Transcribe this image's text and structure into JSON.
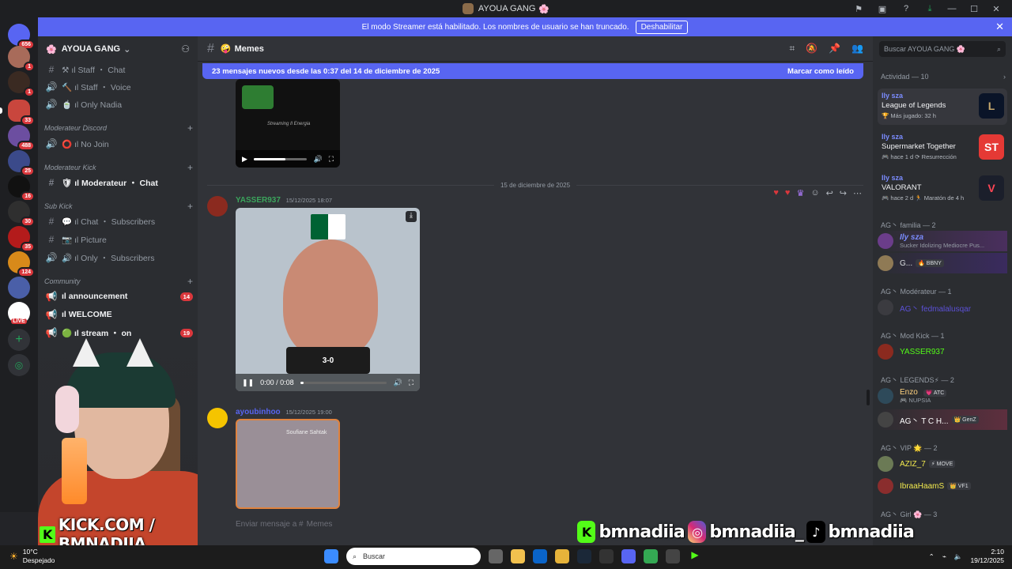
{
  "window": {
    "title": "AYOUA GANG",
    "title_emoji": "🌸"
  },
  "banner": {
    "text": "El modo Streamer está habilitado. Los nombres de usuario se han truncado.",
    "button": "Deshabilitar"
  },
  "servers": {
    "badges": [
      "656",
      "1",
      "1",
      "33",
      "488",
      "25",
      "16",
      "30",
      "35",
      "124"
    ],
    "live_label": "LIVE"
  },
  "guild": {
    "name": "AYOUA GANG",
    "emoji": "🌸"
  },
  "channels": [
    {
      "icon": "#",
      "label": "⚒ ıl Staff ・ Chat"
    },
    {
      "icon": "🔊",
      "label": "🔨 ıl Staff ・ Voice"
    },
    {
      "icon": "🔊",
      "label": "🍵 ıl Only Nadia"
    },
    {
      "category": "Moderateur Discord"
    },
    {
      "icon": "🔊",
      "label": "⭕ ıl No Join"
    },
    {
      "category": "Moderateur Kick"
    },
    {
      "icon": "#",
      "label": "🛡 ıl Moderateur ・ Chat",
      "bold": true
    },
    {
      "category": "Sub Kick"
    },
    {
      "icon": "#",
      "label": "💬 ıl Chat ・ Subscribers"
    },
    {
      "icon": "#",
      "label": "📷 ıl Picture"
    },
    {
      "icon": "🔊",
      "label": "🔊 ıl Only ・ Subscribers"
    },
    {
      "category": "Community"
    },
    {
      "icon": "📢",
      "label": "ıl announcement",
      "bold": true,
      "badge": "14"
    },
    {
      "icon": "📢",
      "label": "ıl WELCOME",
      "bold": true
    },
    {
      "icon": "📢",
      "label": "🟢 ıl stream ・ on",
      "bold": true,
      "badge": "19"
    }
  ],
  "webcam_tag": "KICK.COM / BMNADIIA",
  "chat_header": {
    "name": "Memes",
    "emoji": "🤪"
  },
  "new_messages": {
    "text": "23 mensajes nuevos desde las 0:37 del 14 de diciembre de 2025",
    "mark": "Marcar como leído"
  },
  "messages": [
    {
      "author": "YASSER937",
      "time": "15/12/2025 18:07",
      "color": "#3ba55c",
      "video_time": "0:00 / 0:08",
      "score": "3-0"
    },
    {
      "author": "ayoubinhoo",
      "time": "15/12/2025 19:00",
      "color": "#5865f2",
      "watermark": "Soufiane Sahtak"
    }
  ],
  "date_divider": "15 de diciembre de 2025",
  "first_video_caption": "Streaming Il Energia",
  "composer_placeholder": "Enviar mensaje a #",
  "composer_channel": "Memes",
  "members": {
    "search_placeholder": "Buscar AYOUA GANG 🌸",
    "activity_header": "Actividad — 10",
    "activities": [
      {
        "name": "Ily sza",
        "game": "League of Legends",
        "meta": "🏆 Más jugado: 32 h",
        "art": "L",
        "art_color": "#0a1428"
      },
      {
        "name": "Ily sza",
        "game": "Supermarket Together",
        "meta": "🎮 hace 1 d   ⟳ Resurrección",
        "art": "ST",
        "art_color": "#e53935"
      },
      {
        "name": "Ily sza",
        "game": "VALORANT",
        "meta": "🎮 hace 2 d   🏃 Maratón de 4 h",
        "art": "V",
        "art_color": "#1b1f2b"
      }
    ],
    "groups": [
      {
        "header": "AG丶 familia — 2",
        "members": [
          {
            "name": "Ily sza",
            "sub": "Sucker Idolizing Mediocre Pus...",
            "color": "#7b8cff"
          },
          {
            "name": "G...",
            "tag": "🔥 BBNY",
            "color": "#dbdee1"
          }
        ]
      },
      {
        "header": "AG丶 Modérateur — 1",
        "members": [
          {
            "name": "AG丶 fedmalalusqar",
            "color": "#5b50d6"
          }
        ]
      },
      {
        "header": "AG丶 Mod Kick — 1",
        "members": [
          {
            "name": "YASSER937",
            "color": "#53fc18"
          }
        ]
      },
      {
        "header": "AG丶 LEGENDS⚡ — 2",
        "members": [
          {
            "name": "Enzo",
            "tag": "💗 ATC",
            "sub": "🎮 NUPSIA",
            "color": "#ffd27f"
          },
          {
            "name": "AG丶 T C H...",
            "tag": "👑 GenZ",
            "color": "#ffffff"
          }
        ]
      },
      {
        "header": "AG丶 VIP 🌟 — 2",
        "members": [
          {
            "name": "AZIZ_7",
            "tag": "⚡ MOVE",
            "color": "#f2e94e"
          },
          {
            "name": "IbraaHaamS",
            "tag": "👑 VF1",
            "color": "#f2e94e"
          }
        ]
      },
      {
        "header": "AG丶 Girl 🌸 — 3",
        "members": []
      }
    ]
  },
  "overlay_handles": [
    "bmnadiia",
    "bmnadiia_",
    "bmnadiia"
  ],
  "taskbar": {
    "weather_temp": "10°C",
    "weather_desc": "Despejado",
    "search": "Buscar",
    "time": "2:10",
    "date": "19/12/2025"
  }
}
